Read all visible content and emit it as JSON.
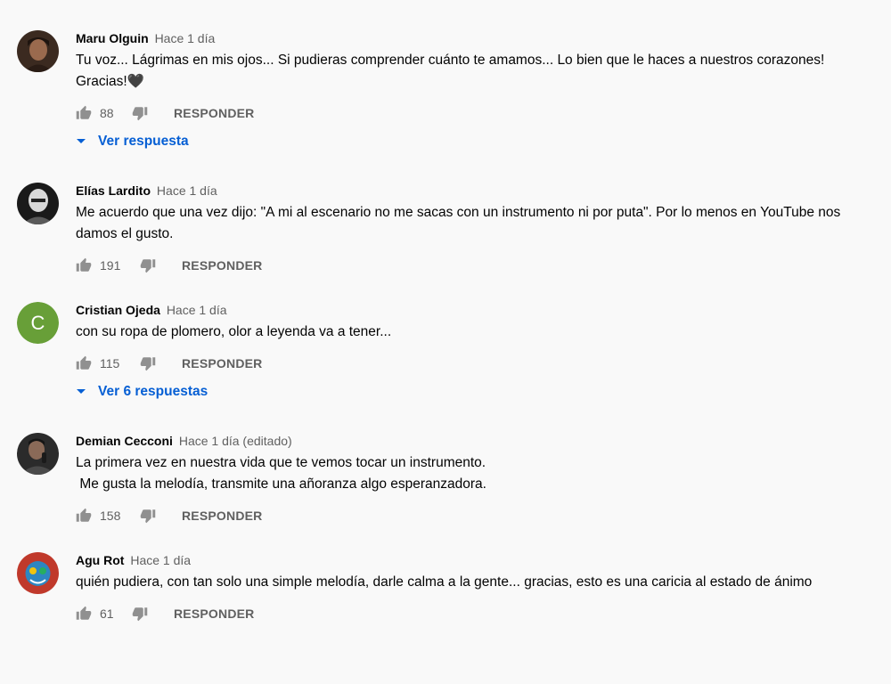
{
  "reply_label": "RESPONDER",
  "accent": "#065fd4",
  "comments": [
    {
      "author": "Maru Olguin",
      "time": "Hace 1 día",
      "text": "Tu voz... Lágrimas en mis ojos... Si pudieras comprender cuánto te amamos... Lo bien que le haces a nuestros corazones! Gracias!🖤",
      "likes": "88",
      "replies_label": "Ver respuesta"
    },
    {
      "author": "Elías Lardito",
      "time": "Hace 1 día",
      "text": "Me acuerdo que una vez dijo: \"A mi al escenario no me sacas con un instrumento ni por puta\". Por lo menos en YouTube nos damos el gusto.",
      "likes": "191"
    },
    {
      "author": "Cristian Ojeda",
      "time": "Hace 1 día",
      "text": "con su ropa de plomero, olor a leyenda va a tener...",
      "likes": "115",
      "replies_label": "Ver 6 respuestas",
      "avatar_letter": "C",
      "avatar_color": "#689f38"
    },
    {
      "author": "Demian Cecconi",
      "time": "Hace 1 día (editado)",
      "text": "La primera vez en nuestra vida que te vemos tocar un instrumento.\n Me gusta la melodía, transmite una añoranza algo esperanzadora.",
      "likes": "158"
    },
    {
      "author": "Agu Rot",
      "time": "Hace 1 día",
      "text": "quién pudiera, con tan solo una simple melodía, darle calma a la gente... gracias, esto es una caricia al estado de ánimo",
      "likes": "61"
    }
  ]
}
